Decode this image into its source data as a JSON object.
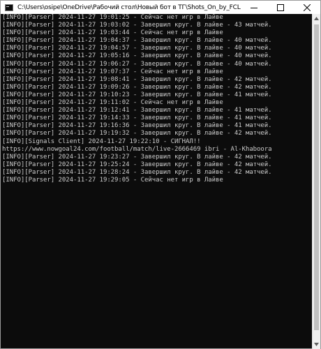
{
  "window": {
    "title": "C:\\Users\\osipe\\OneDrive\\Рабочий стол\\Новый бот в ТГ\\Shots_On_by_FCLans.exe",
    "icon": "console-app-icon",
    "controls": {
      "minimize": "minimize-icon",
      "maximize": "maximize-icon",
      "close": "close-icon"
    }
  },
  "colors": {
    "console_bg": "#0c0c0c",
    "console_text": "#cccccc",
    "titlebar_bg": "#ffffff"
  },
  "console": {
    "lines": [
      "[INFO][Parser] 2024-11-27 19:01:25 - Сейчас нет игр в Лайве",
      "[INFO][Parser] 2024-11-27 19:03:02 - Завершил круг. В лайве - 43 матчей.",
      "[INFO][Parser] 2024-11-27 19:03:44 - Сейчас нет игр в Лайве",
      "[INFO][Parser] 2024-11-27 19:04:37 - Завершил круг. В лайве - 40 матчей.",
      "[INFO][Parser] 2024-11-27 19:04:57 - Завершил круг. В лайве - 40 матчей.",
      "[INFO][Parser] 2024-11-27 19:05:16 - Завершил круг. В лайве - 40 матчей.",
      "[INFO][Parser] 2024-11-27 19:06:27 - Завершил круг. В лайве - 40 матчей.",
      "[INFO][Parser] 2024-11-27 19:07:37 - Сейчас нет игр в Лайве",
      "[INFO][Parser] 2024-11-27 19:08:41 - Завершил круг. В лайве - 42 матчей.",
      "[INFO][Parser] 2024-11-27 19:09:26 - Завершил круг. В лайве - 42 матчей.",
      "[INFO][Parser] 2024-11-27 19:10:23 - Завершил круг. В лайве - 41 матчей.",
      "[INFO][Parser] 2024-11-27 19:11:02 - Сейчас нет игр в Лайве",
      "[INFO][Parser] 2024-11-27 19:12:41 - Завершил круг. В лайве - 41 матчей.",
      "[INFO][Parser] 2024-11-27 19:14:33 - Завершил круг. В лайве - 41 матчей.",
      "[INFO][Parser] 2024-11-27 19:16:36 - Завершил круг. В лайве - 41 матчей.",
      "[INFO][Parser] 2024-11-27 19:19:32 - Завершил круг. В лайве - 42 матчей.",
      "[INFO][Signals Client] 2024-11-27 19:22:10 - СИГНАЛ!!",
      "https://www.nowgoal24.com/football/match/live-2666469 ibri - Al-Khaboora",
      "[INFO][Parser] 2024-11-27 19:23:27 - Завершил круг. В лайве - 42 матчей.",
      "[INFO][Parser] 2024-11-27 19:25:24 - Завершил круг. В лайве - 42 матчей.",
      "[INFO][Parser] 2024-11-27 19:28:24 - Завершил круг. В лайве - 42 матчей.",
      "[INFO][Parser] 2024-11-27 19:29:05 - Сейчас нет игр в Лайве"
    ]
  }
}
